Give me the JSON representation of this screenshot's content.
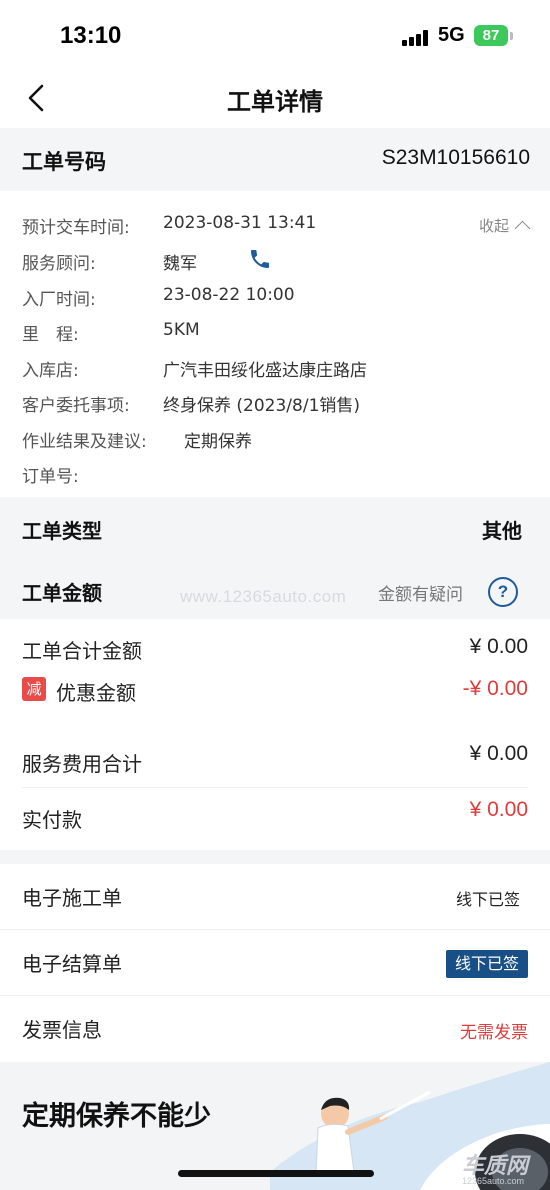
{
  "status_bar": {
    "time": "13:10",
    "network": "5G",
    "battery": "87"
  },
  "header": {
    "title": "工单详情"
  },
  "order": {
    "label": "工单号码",
    "number": "S23M10156610"
  },
  "details": {
    "collapse_label": "收起",
    "rows": [
      {
        "label": "预计交车时间:",
        "value": "2023-08-31 13:41"
      },
      {
        "label": "服务顾问:",
        "value": "魏军"
      },
      {
        "label": "入厂时间:",
        "value": "23-08-22 10:00"
      },
      {
        "label": "里　程:",
        "value": "5KM"
      },
      {
        "label": "入库店:",
        "value": "广汽丰田绥化盛达康庄路店"
      },
      {
        "label": "客户委托事项:",
        "value": "终身保养 (2023/8/1销售)"
      },
      {
        "label": "作业结果及建议:",
        "value": "定期保养"
      },
      {
        "label": "订单号:",
        "value": ""
      }
    ]
  },
  "order_type": {
    "label": "工单类型",
    "value": "其他"
  },
  "amount_section": {
    "label": "工单金额",
    "watermark": "www.12365auto.com",
    "question_label": "金额有疑问",
    "question_icon": "?"
  },
  "amounts": {
    "total_label": "工单合计金额",
    "total_value": "¥ 0.00",
    "discount_badge": "减",
    "discount_label": "优惠金额",
    "discount_value": "-¥ 0.00",
    "service_label": "服务费用合计",
    "service_value": "¥ 0.00",
    "paid_label": "实付款",
    "paid_value": "¥ 0.00"
  },
  "documents": [
    {
      "label": "电子施工单",
      "status": "线下已签"
    },
    {
      "label": "电子结算单",
      "status": "线下已签"
    },
    {
      "label": "发票信息",
      "status": "无需发票"
    }
  ],
  "banner": {
    "title": "定期保养不能少"
  },
  "watermark_logo": {
    "text": "车质网",
    "sub": "12365auto.com"
  },
  "colors": {
    "accent": "#174f86",
    "red": "#e03c3c",
    "section_bg": "#f4f5f7"
  },
  "icons": [
    "back-arrow-icon",
    "phone-icon",
    "chevron-up-icon",
    "question-icon",
    "signal-icon",
    "battery-icon"
  ]
}
